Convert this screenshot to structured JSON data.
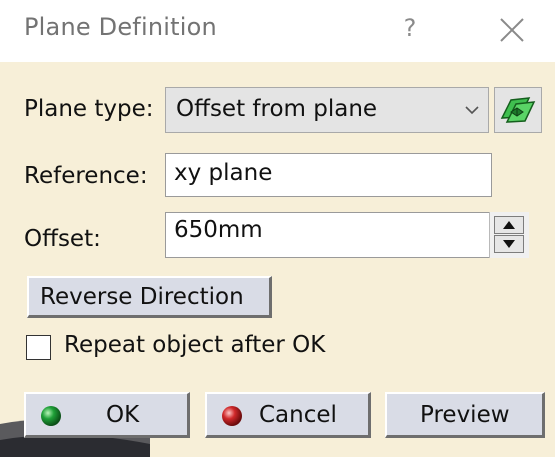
{
  "window": {
    "title": "Plane Definition",
    "help_label": "?",
    "close_icon": "close-icon"
  },
  "plane_type": {
    "label": "Plane type:",
    "selected": "Offset from plane",
    "dropdown_icon": "chevron-down-icon",
    "side_icon": "plane-icon"
  },
  "reference": {
    "label": "Reference:",
    "value": "xy plane"
  },
  "offset": {
    "label": "Offset:",
    "value": "650mm"
  },
  "reverse_direction": {
    "label": "Reverse Direction"
  },
  "repeat": {
    "label": "Repeat object after OK",
    "checked": false
  },
  "buttons": {
    "ok": "OK",
    "cancel": "Cancel",
    "preview": "Preview"
  },
  "colors": {
    "dialog_background": "#f7efd8",
    "title_text": "#737373",
    "button_face": "#d9dce6",
    "ok_indicator": "#1fa038",
    "cancel_indicator": "#d0282a"
  }
}
